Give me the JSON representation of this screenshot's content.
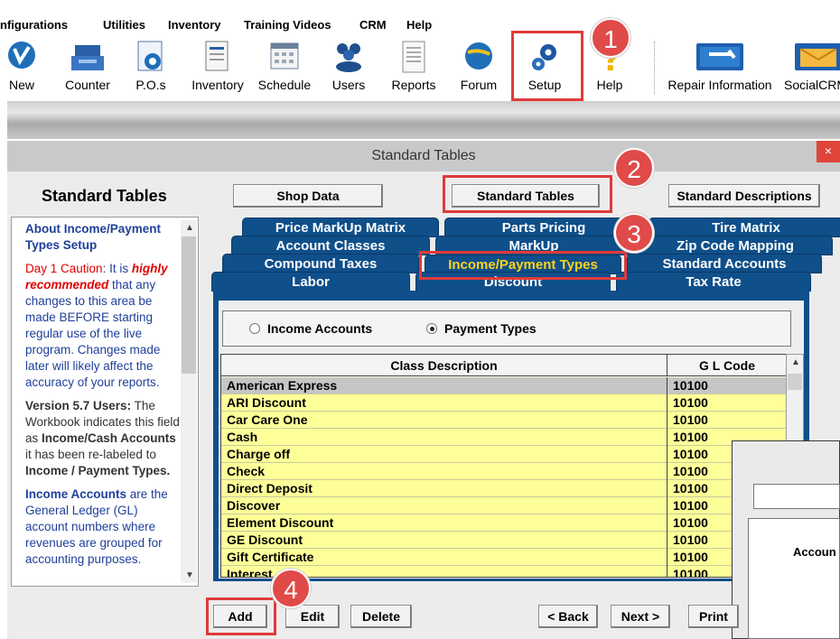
{
  "menu": [
    "nfigurations",
    "Utilities",
    "Inventory",
    "Training Videos",
    "CRM",
    "Help"
  ],
  "toolbar": {
    "items": [
      "New",
      "Counter",
      "P.O.s",
      "Inventory",
      "Schedule",
      "Users",
      "Reports",
      "Forum",
      "Setup",
      "Help",
      "Repair Information",
      "SocialCRM"
    ]
  },
  "dialog": {
    "title": "Standard Tables",
    "close": "×",
    "heading": "Standard Tables",
    "top_buttons": [
      "Shop Data",
      "Standard Tables",
      "Standard Descriptions"
    ]
  },
  "sidebar": {
    "p1_heading": "About Income/Payment Types Setup",
    "p2_caution": "Day 1 Caution",
    "p2_a": ": It is ",
    "p2_em": "highly recommended",
    "p2_b": " that any changes to this area be made BEFORE starting regular use of the live program. Changes made later will likely affect the accuracy of your reports.",
    "p3_lead": "Version 5.7 Users:",
    "p3_a": " The Workbook indicates this field as ",
    "p3_b1": "Income/Cash Accounts",
    "p3_c": " it has been re-labeled to ",
    "p3_b2": "Income / Payment Types.",
    "p4_lead": "Income Accounts",
    "p4_a": " are the General Ledger (GL) account numbers where revenues are grouped for accounting purposes."
  },
  "tabs": {
    "row1": [
      "Price MarkUp Matrix",
      "Parts Pricing",
      "Tire Matrix"
    ],
    "row2": [
      "Account Classes",
      "MarkUp",
      "Zip Code Mapping"
    ],
    "row3": [
      "Compound Taxes",
      "Income/Payment Types",
      "Standard Accounts"
    ],
    "row4": [
      "Labor",
      "Discount",
      "Tax Rate"
    ]
  },
  "radios": {
    "income": "Income Accounts",
    "payment": "Payment Types",
    "selected": "Payment Types"
  },
  "table": {
    "headers": [
      "Class Description",
      "G L Code"
    ],
    "rows": [
      [
        "American Express",
        "10100"
      ],
      [
        "ARI Discount",
        "10100"
      ],
      [
        "Car Care One",
        "10100"
      ],
      [
        "Cash",
        "10100"
      ],
      [
        "Charge off",
        "10100"
      ],
      [
        "Check",
        "10100"
      ],
      [
        "Direct Deposit",
        "10100"
      ],
      [
        "Discover",
        "10100"
      ],
      [
        "Element Discount",
        "10100"
      ],
      [
        "GE Discount",
        "10100"
      ],
      [
        "Gift Certificate",
        "10100"
      ],
      [
        "Interest",
        "10100"
      ]
    ]
  },
  "bottom_buttons": [
    "Add",
    "Edit",
    "Delete",
    "< Back",
    "Next >",
    "Print"
  ],
  "overlay": {
    "label": "Accoun"
  },
  "callouts": [
    "1",
    "2",
    "3",
    "4"
  ],
  "colors": {
    "accent_red": "#e04a48",
    "tab_blue": "#0f4f8a",
    "tab_active_text": "#ffd31a",
    "row_yellow": "#ffff99"
  }
}
